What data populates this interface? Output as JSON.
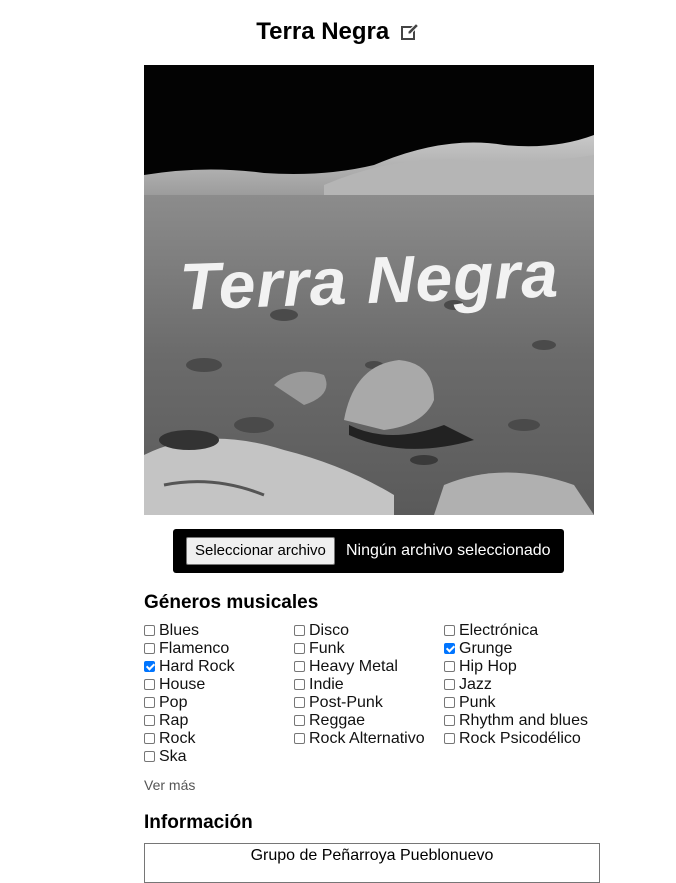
{
  "band": {
    "name": "Terra Negra",
    "cover_text": "Terra Negra"
  },
  "file_input": {
    "button_label": "Seleccionar archivo",
    "status": "Ningún archivo seleccionado"
  },
  "genres_section": {
    "title": "Géneros musicales",
    "more_label": "Ver más",
    "items": [
      {
        "label": "Blues",
        "checked": false
      },
      {
        "label": "Disco",
        "checked": false
      },
      {
        "label": "Electrónica",
        "checked": false
      },
      {
        "label": "Flamenco",
        "checked": false
      },
      {
        "label": "Funk",
        "checked": false
      },
      {
        "label": "Grunge",
        "checked": true
      },
      {
        "label": "Hard Rock",
        "checked": true
      },
      {
        "label": "Heavy Metal",
        "checked": false
      },
      {
        "label": "Hip Hop",
        "checked": false
      },
      {
        "label": "House",
        "checked": false
      },
      {
        "label": "Indie",
        "checked": false
      },
      {
        "label": "Jazz",
        "checked": false
      },
      {
        "label": "Pop",
        "checked": false
      },
      {
        "label": "Post-Punk",
        "checked": false
      },
      {
        "label": "Punk",
        "checked": false
      },
      {
        "label": "Rap",
        "checked": false
      },
      {
        "label": "Reggae",
        "checked": false
      },
      {
        "label": "Rhythm and blues",
        "checked": false
      },
      {
        "label": "Rock",
        "checked": false
      },
      {
        "label": "Rock Alternativo",
        "checked": false
      },
      {
        "label": "Rock Psicodélico",
        "checked": false
      },
      {
        "label": "Ska",
        "checked": false
      }
    ]
  },
  "info_section": {
    "title": "Información",
    "text": "Grupo de Peñarroya Pueblonuevo"
  },
  "colors": {
    "checkbox_checked": "#0075ff",
    "file_bar_bg": "#000000"
  },
  "icons": {
    "edit": "edit-icon"
  }
}
